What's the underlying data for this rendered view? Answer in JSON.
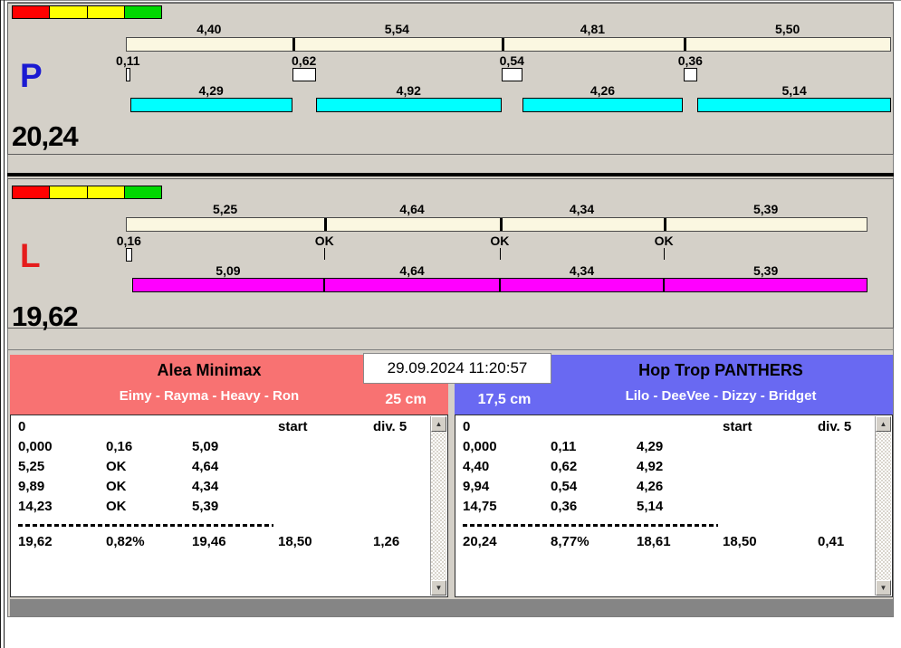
{
  "colors": {
    "window_gray": "#d4d0c8",
    "cream_bar": "#fbf7e1",
    "cyan_bar": "#00ffff",
    "magenta_bar": "#ff00ff",
    "indicator": [
      "#ff0000",
      "#ffff00",
      "#ffff00",
      "#00d800"
    ],
    "team_red": "#f87272",
    "team_blue": "#6969f2",
    "strip_gray": "#858585"
  },
  "icons": {
    "scroll_up": "▲",
    "scroll_down": "▼"
  },
  "timestamp": "29.09.2024 11:20:57",
  "lanes": [
    {
      "id": "p",
      "letter": "P",
      "letter_color": "#1a1ad2",
      "total": "20,24",
      "run_color": "#00ffff",
      "segments": [
        {
          "label": "4,40",
          "seconds": 4.4
        },
        {
          "label": "5,54",
          "seconds": 5.54
        },
        {
          "label": "4,81",
          "seconds": 4.81
        },
        {
          "label": "5,50",
          "seconds": 5.5
        }
      ],
      "exchanges": [
        {
          "label": "0,11",
          "seconds": 0.11
        },
        {
          "label": "0,62",
          "seconds": 0.62
        },
        {
          "label": "0,54",
          "seconds": 0.54
        },
        {
          "label": "0,36",
          "seconds": 0.36
        }
      ],
      "runs": [
        {
          "label": "4,29",
          "seconds": 4.29
        },
        {
          "label": "4,92",
          "seconds": 4.92
        },
        {
          "label": "4,26",
          "seconds": 4.26
        },
        {
          "label": "5,14",
          "seconds": 5.14
        }
      ]
    },
    {
      "id": "l",
      "letter": "L",
      "letter_color": "#e51c1c",
      "total": "19,62",
      "run_color": "#ff00ff",
      "segments": [
        {
          "label": "5,25",
          "seconds": 5.25
        },
        {
          "label": "4,64",
          "seconds": 4.64
        },
        {
          "label": "4,34",
          "seconds": 4.34
        },
        {
          "label": "5,39",
          "seconds": 5.39
        }
      ],
      "exchanges": [
        {
          "label": "0,16",
          "seconds": 0.16
        },
        {
          "label": "OK",
          "seconds": 0
        },
        {
          "label": "OK",
          "seconds": 0
        },
        {
          "label": "OK",
          "seconds": 0
        }
      ],
      "runs": [
        {
          "label": "5,09",
          "seconds": 5.09
        },
        {
          "label": "4,64",
          "seconds": 4.64
        },
        {
          "label": "4,34",
          "seconds": 4.34
        },
        {
          "label": "5,39",
          "seconds": 5.39
        }
      ]
    }
  ],
  "teams": [
    {
      "name": "Alea Minimax",
      "members": "Eimy - Rayma - Heavy - Ron",
      "size": "25 cm",
      "theme_color": "#f87272",
      "table": {
        "header_row": [
          "0",
          "start",
          "div. 5"
        ],
        "rows": [
          [
            "0,000",
            "0,16",
            "5,09"
          ],
          [
            "5,25",
            "OK",
            "4,64"
          ],
          [
            "9,89",
            "OK",
            "4,34"
          ],
          [
            "14,23",
            "OK",
            "5,39"
          ]
        ],
        "total_row": [
          "19,62",
          "0,82%",
          "19,46",
          "18,50",
          "1,26"
        ]
      }
    },
    {
      "name": "Hop Trop PANTHERS",
      "members": "Lilo - DeeVee - Dizzy - Bridget",
      "size": "17,5 cm",
      "theme_color": "#6969f2",
      "table": {
        "header_row": [
          "0",
          "start",
          "div. 5"
        ],
        "rows": [
          [
            "0,000",
            "0,11",
            "4,29"
          ],
          [
            "4,40",
            "0,62",
            "4,92"
          ],
          [
            "9,94",
            "0,54",
            "4,26"
          ],
          [
            "14,75",
            "0,36",
            "5,14"
          ]
        ],
        "total_row": [
          "20,24",
          "8,77%",
          "18,61",
          "18,50",
          "0,41"
        ]
      }
    }
  ]
}
